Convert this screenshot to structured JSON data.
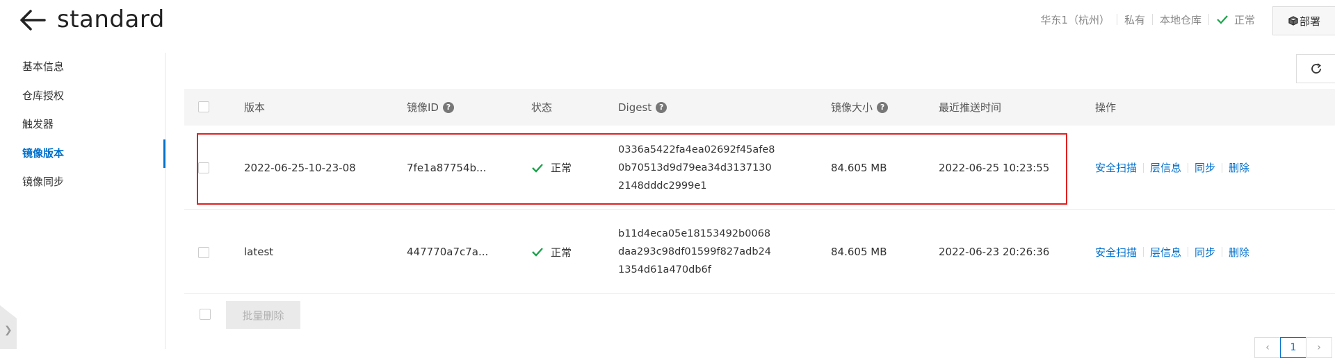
{
  "header": {
    "title": "standard",
    "region": "华东1（杭州）",
    "visibility": "私有",
    "repo_type": "本地仓库",
    "status": "正常",
    "deploy_label": "部署"
  },
  "sidebar": {
    "items": [
      {
        "label": "基本信息",
        "active": false
      },
      {
        "label": "仓库授权",
        "active": false
      },
      {
        "label": "触发器",
        "active": false
      },
      {
        "label": "镜像版本",
        "active": true
      },
      {
        "label": "镜像同步",
        "active": false
      }
    ]
  },
  "table": {
    "columns": [
      "版本",
      "镜像ID",
      "状态",
      "Digest",
      "镜像大小",
      "最近推送时间",
      "操作"
    ],
    "rows": [
      {
        "version": "2022-06-25-10-23-08",
        "image_id": "7fe1a87754b...",
        "status": "正常",
        "digest": [
          "0336a5422fa4ea02692f45afe8",
          "0b70513d9d79ea34d3137130",
          "2148dddc2999e1"
        ],
        "size": "84.605 MB",
        "pushed": "2022-06-25 10:23:55"
      },
      {
        "version": "latest",
        "image_id": "447770a7c7a...",
        "status": "正常",
        "digest": [
          "b11d4eca05e18153492b0068",
          "daa293c98df01599f827adb24",
          "1354d61a470db6f"
        ],
        "size": "84.605 MB",
        "pushed": "2022-06-23 20:26:36"
      }
    ],
    "actions": [
      "安全扫描",
      "层信息",
      "同步",
      "删除"
    ]
  },
  "footer": {
    "batch_delete_label": "批量删除",
    "page": "1"
  },
  "colors": {
    "accent": "#0070cc",
    "success": "#1aa34a",
    "highlight": "#e02020"
  }
}
